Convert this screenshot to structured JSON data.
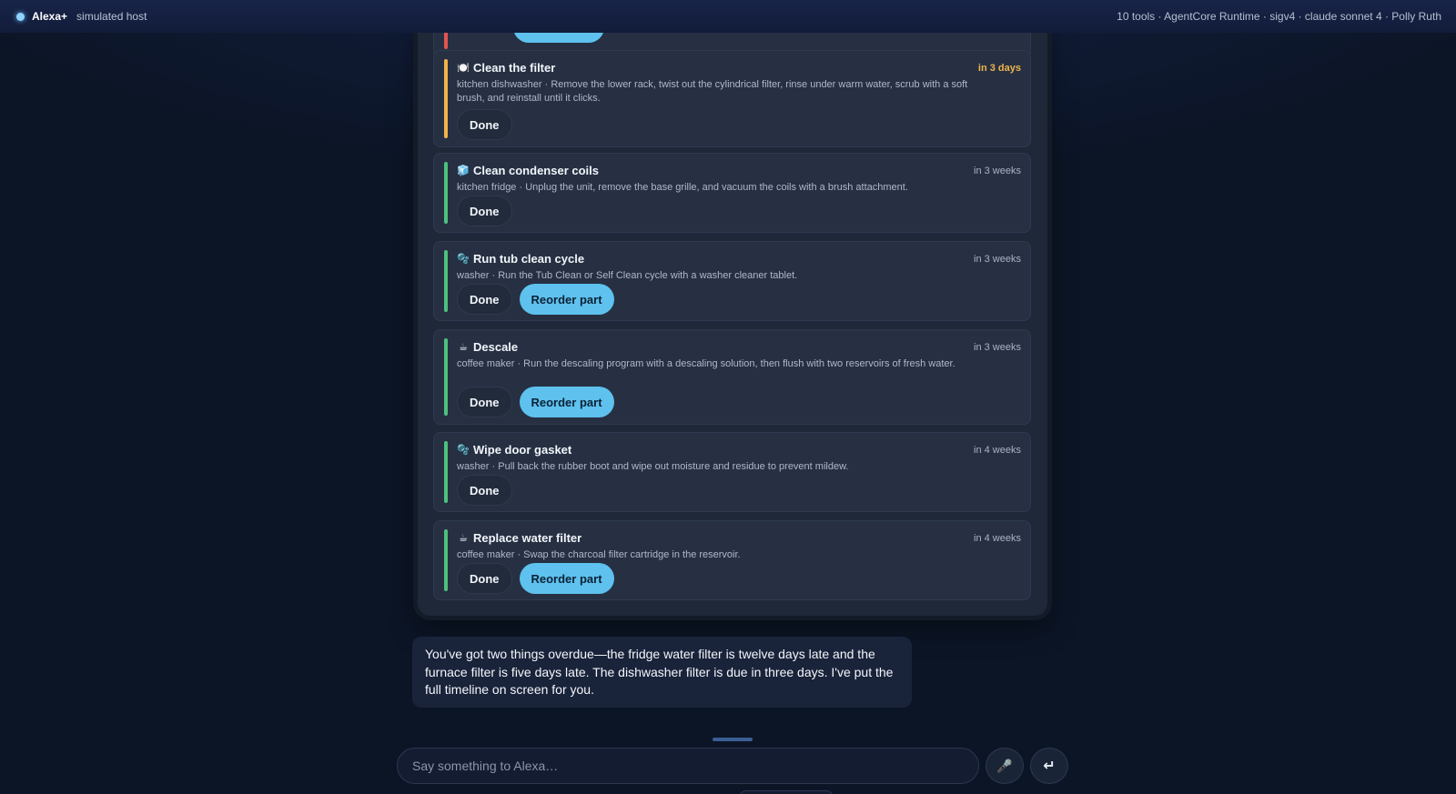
{
  "header": {
    "brand": "Alexa+",
    "host": "simulated host",
    "info": "10 tools · AgentCore Runtime · sigv4 · claude sonnet 4 · Polly Ruth"
  },
  "tasks": [
    {
      "icon": "🍽️",
      "title": "Clean the filter",
      "device": "kitchen dishwasher",
      "desc": "kitchen dishwasher · Remove the lower rack, twist out the cylindrical filter, rinse under warm water, scrub with a soft brush, and reinstall until it clicks.",
      "due": "in 3 days",
      "status": "soon",
      "done_label": "Done"
    },
    {
      "icon": "🧊",
      "title": "Clean condenser coils",
      "desc": "kitchen fridge · Unplug the unit, remove the base grille, and vacuum the coils with a brush attachment.",
      "due": "in 3 weeks",
      "status": "ok",
      "done_label": "Done"
    },
    {
      "icon": "🫧",
      "title": "Run tub clean cycle",
      "desc": "washer · Run the Tub Clean or Self Clean cycle with a washer cleaner tablet.",
      "due": "in 3 weeks",
      "status": "ok",
      "done_label": "Done",
      "reorder_label": "Reorder part"
    },
    {
      "icon": "☕",
      "title": "Descale",
      "desc": "coffee maker · Run the descaling program with a descaling solution, then flush with two reservoirs of fresh water.",
      "due": "in 3 weeks",
      "status": "ok",
      "done_label": "Done",
      "reorder_label": "Reorder part"
    },
    {
      "icon": "🫧",
      "title": "Wipe door gasket",
      "desc": "washer · Pull back the rubber boot and wipe out moisture and residue to prevent mildew.",
      "due": "in 4 weeks",
      "status": "ok",
      "done_label": "Done"
    },
    {
      "icon": "☕",
      "title": "Replace water filter",
      "desc": "coffee maker · Swap the charcoal filter cartridge in the reservoir.",
      "due": "in 4 weeks",
      "status": "ok",
      "done_label": "Done",
      "reorder_label": "Reorder part"
    }
  ],
  "assistant_message": "You've got two things overdue—the fridge water filter is twelve days late and the furnace filter is five days late. The dishwasher filter is due in three days. I've put the full timeline on screen for you.",
  "composer": {
    "placeholder": "Say something to Alexa…",
    "mic_icon": "microphone-icon",
    "send_icon": "enter-icon"
  },
  "colors": {
    "overdue": "#e0564e",
    "soon": "#f0b34a",
    "ok": "#4fc07d",
    "accent": "#5ec1ee"
  }
}
